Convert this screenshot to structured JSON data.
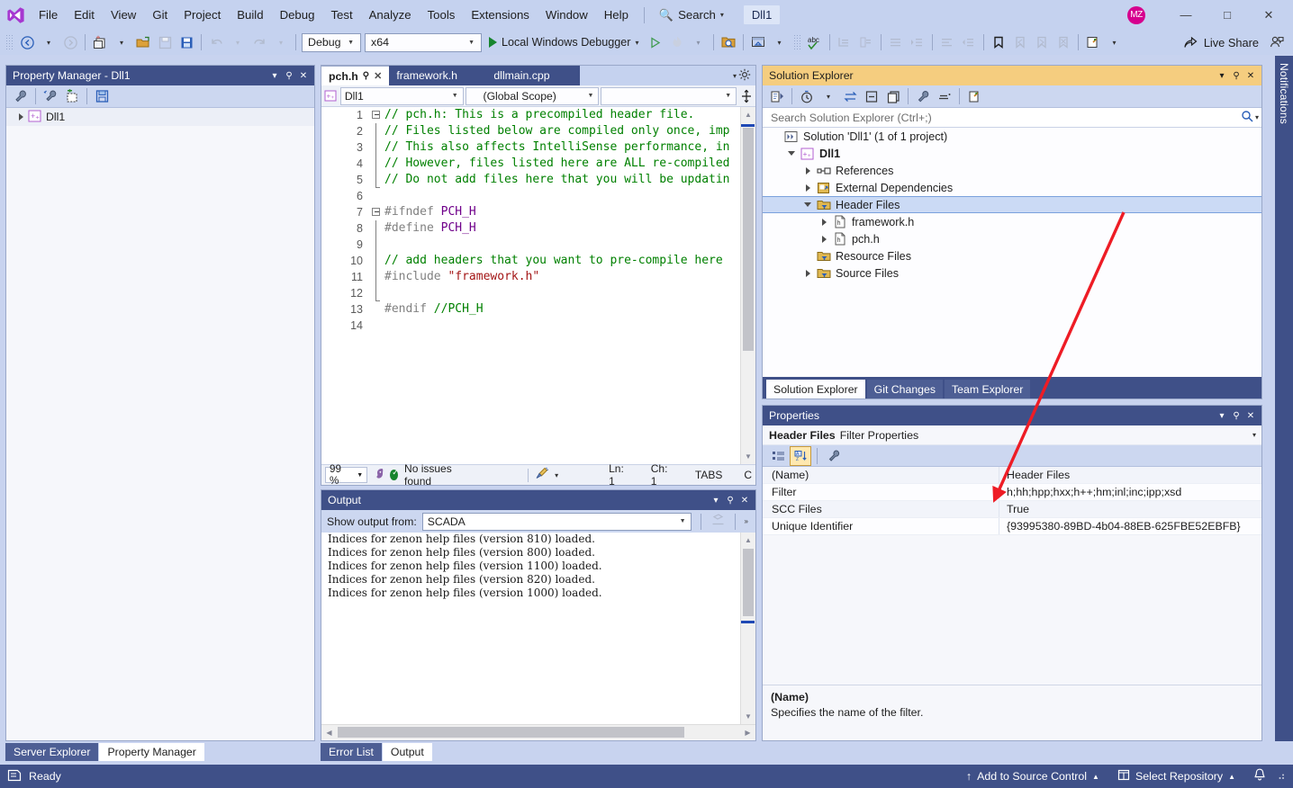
{
  "window": {
    "title_chip": "Dll1",
    "avatar_initials": "MZ",
    "minimize": "—",
    "maximize": "□",
    "close": "✕"
  },
  "menu": {
    "items": [
      "File",
      "Edit",
      "View",
      "Git",
      "Project",
      "Build",
      "Debug",
      "Test",
      "Analyze",
      "Tools",
      "Extensions",
      "Window",
      "Help"
    ],
    "search_label": "Search"
  },
  "toolbar": {
    "config": "Debug",
    "platform": "x64",
    "run_label": "Local Windows Debugger",
    "live_share": "Live Share",
    "icons": [
      "navigate-back-icon",
      "navigate-forward-icon",
      "new-project-icon",
      "open-file-icon",
      "save-icon",
      "save-all-icon",
      "undo-icon",
      "redo-icon",
      "start-debug-icon",
      "attach-process-icon",
      "hot-reload-icon",
      "find-in-files-icon",
      "toolbox-icon",
      "spell-check-icon",
      "comment-icon",
      "uncomment-icon",
      "decrease-indent-icon",
      "increase-indent-icon",
      "bookmark-icon",
      "prev-bookmark-icon",
      "next-bookmark-icon",
      "clear-bookmarks-icon",
      "new-window-icon"
    ]
  },
  "property_manager": {
    "title": "Property Manager - Dll1",
    "toolbar_icons": [
      "properties-icon",
      "add-property-sheet-icon",
      "add-new-sheet-icon",
      "save-icon"
    ],
    "root_item": "Dll1"
  },
  "editor": {
    "tabs": [
      {
        "label": "pch.h",
        "active": true
      },
      {
        "label": "framework.h",
        "active": false
      },
      {
        "label": "dllmain.cpp",
        "active": false
      }
    ],
    "nav_project": "Dll1",
    "nav_scope": "(Global Scope)",
    "nav_member": "",
    "lines": [
      {
        "n": 1,
        "fold": "start",
        "segments": [
          {
            "t": "// pch.h: This is a precompiled header file.",
            "c": "c-comment"
          }
        ]
      },
      {
        "n": 2,
        "fold": "mid",
        "segments": [
          {
            "t": "// Files listed below are compiled only once, imp",
            "c": "c-comment"
          }
        ]
      },
      {
        "n": 3,
        "fold": "mid",
        "segments": [
          {
            "t": "// This also affects IntelliSense performance, in",
            "c": "c-comment"
          }
        ]
      },
      {
        "n": 4,
        "fold": "mid",
        "segments": [
          {
            "t": "// However, files listed here are ALL re-compiled",
            "c": "c-comment"
          }
        ]
      },
      {
        "n": 5,
        "fold": "end",
        "segments": [
          {
            "t": "// Do not add files here that you will be updatin",
            "c": "c-comment"
          }
        ]
      },
      {
        "n": 6,
        "fold": "none",
        "segments": []
      },
      {
        "n": 7,
        "fold": "start2",
        "segments": [
          {
            "t": "#ifndef ",
            "c": "c-pp"
          },
          {
            "t": "PCH_H",
            "c": "c-macro"
          }
        ]
      },
      {
        "n": 8,
        "fold": "mid",
        "segments": [
          {
            "t": "#define ",
            "c": "c-pp"
          },
          {
            "t": "PCH_H",
            "c": "c-macro"
          }
        ]
      },
      {
        "n": 9,
        "fold": "mid",
        "segments": []
      },
      {
        "n": 10,
        "fold": "mid",
        "segments": [
          {
            "t": "// add headers that you want to pre-compile here",
            "c": "c-comment"
          }
        ]
      },
      {
        "n": 11,
        "fold": "mid",
        "segments": [
          {
            "t": "#include ",
            "c": "c-pp"
          },
          {
            "t": "\"framework.h\"",
            "c": "c-str"
          }
        ]
      },
      {
        "n": 12,
        "fold": "end",
        "segments": []
      },
      {
        "n": 13,
        "fold": "none",
        "segments": [
          {
            "t": "#endif ",
            "c": "c-pp"
          },
          {
            "t": "//PCH_H",
            "c": "c-comment"
          }
        ]
      },
      {
        "n": 14,
        "fold": "none",
        "segments": []
      }
    ],
    "status": {
      "zoom": "99 %",
      "issues": "No issues found",
      "line": "Ln: 1",
      "char": "Ch: 1",
      "tabs": "TABS",
      "extra": "C"
    }
  },
  "output": {
    "title": "Output",
    "show_output_from_label": "Show output from:",
    "source": "SCADA",
    "lines": [
      "Indices for zenon help files (version 810) loaded.",
      "Indices for zenon help files (version 800) loaded.",
      "Indices for zenon help files (version 1100) loaded.",
      "Indices for zenon help files (version 820) loaded.",
      "Indices for zenon help files (version 1000) loaded."
    ]
  },
  "solution_explorer": {
    "title": "Solution Explorer",
    "search_placeholder": "Search Solution Explorer (Ctrl+;)",
    "toolbar_icons": [
      "home-icon",
      "pending-changes-icon",
      "sync-views-icon",
      "collapse-all-icon",
      "show-all-files-icon",
      "properties-icon",
      "preview-selected-icon",
      "new-view-icon"
    ],
    "tree": [
      {
        "label": "Solution 'Dll1' (1 of 1 project)",
        "indent": 0,
        "expander": "none",
        "icon": "solution-icon",
        "bold": false,
        "selected": false
      },
      {
        "label": "Dll1",
        "indent": 1,
        "expander": "down",
        "icon": "cpp-project-icon",
        "bold": true,
        "selected": false
      },
      {
        "label": "References",
        "indent": 2,
        "expander": "right",
        "icon": "references-icon",
        "bold": false,
        "selected": false
      },
      {
        "label": "External Dependencies",
        "indent": 2,
        "expander": "right",
        "icon": "external-dependencies-icon",
        "bold": false,
        "selected": false
      },
      {
        "label": "Header Files",
        "indent": 2,
        "expander": "down",
        "icon": "filter-folder-icon",
        "bold": false,
        "selected": true
      },
      {
        "label": "framework.h",
        "indent": 3,
        "expander": "right",
        "icon": "header-file-icon",
        "bold": false,
        "selected": false
      },
      {
        "label": "pch.h",
        "indent": 3,
        "expander": "right",
        "icon": "header-file-icon",
        "bold": false,
        "selected": false
      },
      {
        "label": "Resource Files",
        "indent": 2,
        "expander": "none",
        "icon": "filter-folder-icon",
        "bold": false,
        "selected": false
      },
      {
        "label": "Source Files",
        "indent": 2,
        "expander": "right",
        "icon": "filter-folder-icon",
        "bold": false,
        "selected": false
      }
    ],
    "tabs": [
      {
        "label": "Solution Explorer",
        "active": true
      },
      {
        "label": "Git Changes",
        "active": false
      },
      {
        "label": "Team Explorer",
        "active": false
      }
    ]
  },
  "properties": {
    "title": "Properties",
    "subject": "Header Files",
    "subject_kind": "Filter Properties",
    "toolbar_icons": [
      "categorized-icon",
      "alphabetical-icon",
      "property-pages-icon"
    ],
    "rows": [
      {
        "name": "(Name)",
        "value": "Header Files"
      },
      {
        "name": "Filter",
        "value": "h;hh;hpp;hxx;h++;hm;inl;inc;ipp;xsd"
      },
      {
        "name": "SCC Files",
        "value": "True"
      },
      {
        "name": "Unique Identifier",
        "value": "{93995380-89BD-4b04-88EB-625FBE52EBFB}"
      }
    ],
    "description_title": "(Name)",
    "description_text": "Specifies the name of the filter."
  },
  "bottom_tabs_left": [
    {
      "label": "Server Explorer",
      "active": false
    },
    {
      "label": "Property Manager",
      "active": true
    }
  ],
  "bottom_tabs_center": [
    {
      "label": "Error List",
      "active": false
    },
    {
      "label": "Output",
      "active": true
    }
  ],
  "statusbar": {
    "ready": "Ready",
    "add_to_source_control": "Add to Source Control",
    "select_repository": "Select Repository"
  },
  "notifications": {
    "label": "Notifications"
  },
  "colors": {
    "chrome": "#c5d2ef",
    "tool_header_inactive": "#3f5088",
    "tool_header_active": "#f5cd7f",
    "selection": "#cbdaf5",
    "annotation_arrow": "#ee1c25",
    "comment_green": "#008000",
    "macro_purple": "#6f008a",
    "string_red": "#a31515",
    "avatar_pink": "#d6008e"
  }
}
